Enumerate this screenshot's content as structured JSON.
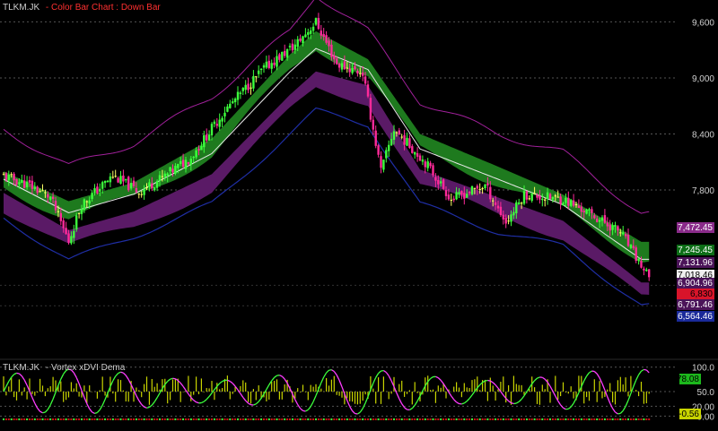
{
  "chart_data": [
    {
      "type": "candlestick",
      "panel": "main",
      "title": "TLKM.JK",
      "subtitle": "- Color Bar Chart : Down Bar",
      "yticks": [
        9600,
        9000,
        8400,
        7800
      ],
      "ytick_labels": [
        "9,600",
        "9,000",
        "8,400",
        "7,800"
      ],
      "ylim": [
        6380,
        9700
      ],
      "grid": true,
      "price_path": [
        {
          "i": 0,
          "v": 7950
        },
        {
          "i": 10,
          "v": 7850
        },
        {
          "i": 18,
          "v": 7720
        },
        {
          "i": 25,
          "v": 7250
        },
        {
          "i": 30,
          "v": 7650
        },
        {
          "i": 42,
          "v": 7950
        },
        {
          "i": 52,
          "v": 7780
        },
        {
          "i": 62,
          "v": 7950
        },
        {
          "i": 72,
          "v": 8150
        },
        {
          "i": 85,
          "v": 8650
        },
        {
          "i": 100,
          "v": 9100
        },
        {
          "i": 112,
          "v": 9350
        },
        {
          "i": 120,
          "v": 9600
        },
        {
          "i": 128,
          "v": 9150
        },
        {
          "i": 138,
          "v": 9050
        },
        {
          "i": 145,
          "v": 8000
        },
        {
          "i": 150,
          "v": 8450
        },
        {
          "i": 162,
          "v": 8100
        },
        {
          "i": 172,
          "v": 7700
        },
        {
          "i": 185,
          "v": 7850
        },
        {
          "i": 193,
          "v": 7450
        },
        {
          "i": 200,
          "v": 7750
        },
        {
          "i": 215,
          "v": 7700
        },
        {
          "i": 225,
          "v": 7550
        },
        {
          "i": 237,
          "v": 7350
        },
        {
          "i": 248,
          "v": 6850
        }
      ],
      "series": [
        {
          "name": "upper band",
          "color": "#a0209a",
          "values": [
            {
              "i": 0,
              "v": 8450
            },
            {
              "i": 25,
              "v": 8050
            },
            {
              "i": 50,
              "v": 8300
            },
            {
              "i": 80,
              "v": 8800
            },
            {
              "i": 110,
              "v": 9500
            },
            {
              "i": 120,
              "v": 9900
            },
            {
              "i": 140,
              "v": 9500
            },
            {
              "i": 160,
              "v": 8750
            },
            {
              "i": 190,
              "v": 8400
            },
            {
              "i": 215,
              "v": 8200
            },
            {
              "i": 245,
              "v": 7550
            }
          ]
        },
        {
          "name": "green band",
          "color": "#1e7a1e",
          "values": [
            {
              "i": 0,
              "v": 8000
            },
            {
              "i": 25,
              "v": 7680
            },
            {
              "i": 50,
              "v": 7880
            },
            {
              "i": 80,
              "v": 8350
            },
            {
              "i": 110,
              "v": 9250
            },
            {
              "i": 120,
              "v": 9500
            },
            {
              "i": 140,
              "v": 9200
            },
            {
              "i": 160,
              "v": 8400
            },
            {
              "i": 190,
              "v": 8050
            },
            {
              "i": 215,
              "v": 7750
            },
            {
              "i": 245,
              "v": 7245
            }
          ]
        },
        {
          "name": "purple band",
          "color": "#5a1a66",
          "values": [
            {
              "i": 0,
              "v": 7750
            },
            {
              "i": 25,
              "v": 7350
            },
            {
              "i": 50,
              "v": 7550
            },
            {
              "i": 80,
              "v": 7950
            },
            {
              "i": 110,
              "v": 8800
            },
            {
              "i": 120,
              "v": 9050
            },
            {
              "i": 140,
              "v": 8900
            },
            {
              "i": 160,
              "v": 8000
            },
            {
              "i": 190,
              "v": 7700
            },
            {
              "i": 215,
              "v": 7450
            },
            {
              "i": 245,
              "v": 6790
            }
          ]
        },
        {
          "name": "lower band",
          "color": "#1f2ea5",
          "values": [
            {
              "i": 0,
              "v": 7500
            },
            {
              "i": 25,
              "v": 7050
            },
            {
              "i": 50,
              "v": 7300
            },
            {
              "i": 80,
              "v": 7650
            },
            {
              "i": 110,
              "v": 8400
            },
            {
              "i": 120,
              "v": 8650
            },
            {
              "i": 140,
              "v": 8500
            },
            {
              "i": 160,
              "v": 7650
            },
            {
              "i": 190,
              "v": 7350
            },
            {
              "i": 215,
              "v": 7200
            },
            {
              "i": 245,
              "v": 6560
            }
          ]
        }
      ],
      "price_labels": [
        {
          "text": "7,472.45",
          "value": 7472.45,
          "bg": "#8a2b8a",
          "fg": "#ffffff"
        },
        {
          "text": "7,245.45",
          "value": 7245.45,
          "bg": "#0d6e17",
          "fg": "#ffffff"
        },
        {
          "text": "7,131.96",
          "value": 7131.96,
          "bg": "#4b1459",
          "fg": "#ffffff"
        },
        {
          "text": "7,018.46",
          "value": 7018.46,
          "bg": "#f0f0f0",
          "fg": "#000000"
        },
        {
          "text": "6,904.96",
          "value": 6904.96,
          "bg": "#4b1459",
          "fg": "#ffffff"
        },
        {
          "text": "6,830",
          "value": 6830,
          "bg": "#d8142a",
          "fg": "#000000"
        },
        {
          "text": "6,791.46",
          "value": 6791.46,
          "bg": "#4b1459",
          "fg": "#ffffff"
        },
        {
          "text": "6,564.46",
          "value": 6564.46,
          "bg": "#1a2a9a",
          "fg": "#ffffff"
        }
      ]
    },
    {
      "type": "oscillator",
      "panel": "indicator",
      "title": "TLKM.JK",
      "subtitle": "- Vortex xDVI Dema",
      "yticks": [
        100,
        50,
        20,
        0
      ],
      "ytick_labels": [
        "100.0",
        "50.0",
        "20.00",
        "0.00"
      ],
      "ylim": [
        -3,
        105
      ],
      "value_labels": [
        {
          "text": "78.08",
          "value": 78.08,
          "bg": "#1cb81c",
          "fg": "#000000"
        },
        {
          "text": "-0.56",
          "value": 6,
          "bg": "#c8d400",
          "fg": "#000000"
        }
      ]
    }
  ],
  "colors": {
    "background": "#000000",
    "up_bar": "#3cff3c",
    "down_bar": "#ff2a9a",
    "neutral_bar": "#ffff66",
    "title_ticker": "#cfcfcf",
    "title_desc": "#ff3030",
    "osc_line_up": "#3cff3c",
    "osc_line_down": "#ff3cff",
    "histogram": "#c8d400",
    "grid": "#555555"
  }
}
